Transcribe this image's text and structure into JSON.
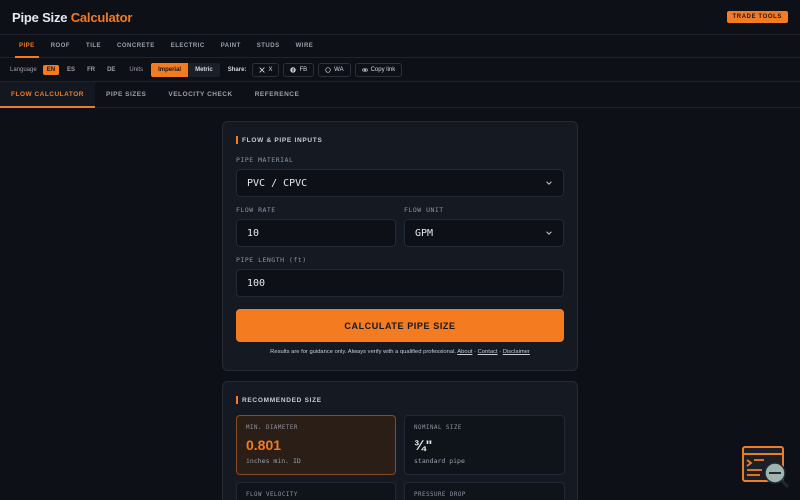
{
  "header": {
    "brand_main": "Pipe Size",
    "brand_accent": "Calculator",
    "trade_tools": "TRADE TOOLS"
  },
  "categories": [
    "PIPE",
    "ROOF",
    "TILE",
    "CONCRETE",
    "ELECTRIC",
    "PAINT",
    "STUDS",
    "WIRE"
  ],
  "settings": {
    "language_label": "Language",
    "languages": [
      "EN",
      "ES",
      "FR",
      "DE"
    ],
    "units_label": "Units",
    "units": [
      "Imperial",
      "Metric"
    ],
    "share_label": "Share:",
    "share": [
      {
        "label": "X",
        "icon": "x-icon"
      },
      {
        "label": "FB",
        "icon": "facebook-icon"
      },
      {
        "label": "WA",
        "icon": "whatsapp-icon"
      },
      {
        "label": "Copy link",
        "icon": "link-icon"
      }
    ]
  },
  "subtabs": [
    "FLOW CALCULATOR",
    "PIPE SIZES",
    "VELOCITY CHECK",
    "REFERENCE"
  ],
  "inputs": {
    "title": "FLOW & PIPE INPUTS",
    "material_label": "PIPE MATERIAL",
    "material_value": "PVC / CPVC",
    "flow_rate_label": "FLOW RATE",
    "flow_rate_value": "10",
    "flow_unit_label": "FLOW UNIT",
    "flow_unit_value": "GPM",
    "length_label": "PIPE LENGTH (ft)",
    "length_value": "100",
    "calculate": "CALCULATE PIPE SIZE",
    "disclaimer": "Results are for guidance only. Always verify with a qualified professional.",
    "links": [
      "About",
      "Contact",
      "Disclaimer"
    ]
  },
  "results": {
    "title": "RECOMMENDED SIZE",
    "min_diameter_label": "MIN. DIAMETER",
    "min_diameter_value": "0.801",
    "min_diameter_sub": "inches min. ID",
    "nominal_label": "NOMINAL SIZE",
    "nominal_value": "¾\"",
    "nominal_sub": "standard pipe",
    "velocity_label": "FLOW VELOCITY",
    "pressure_label": "PRESSURE DROP"
  },
  "colors": {
    "accent": "#f47b20",
    "background": "#0d1017",
    "card": "#151a22"
  }
}
